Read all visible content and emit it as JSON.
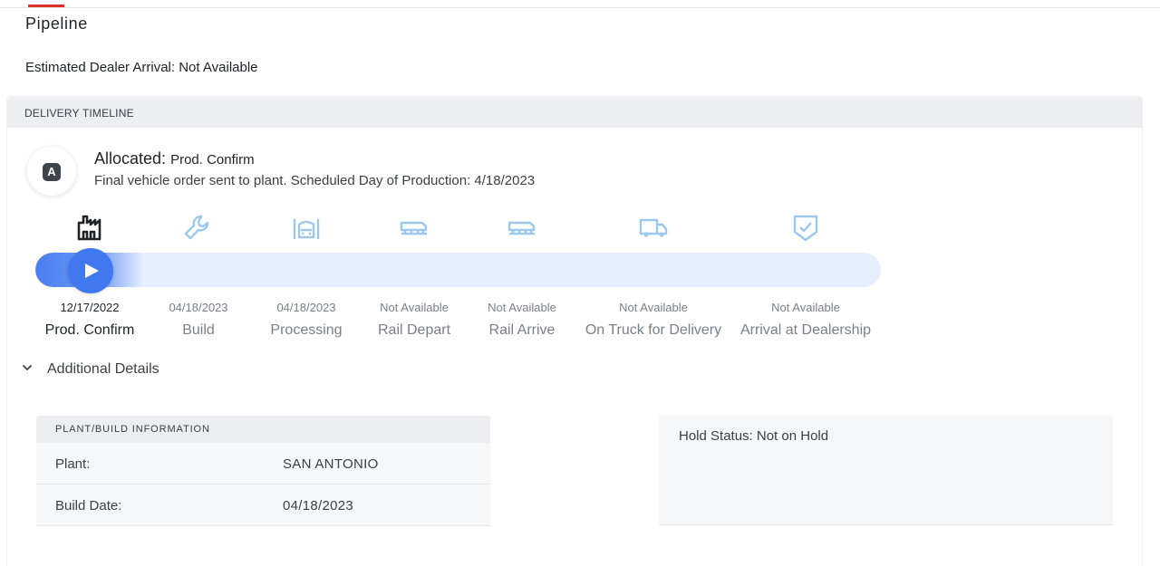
{
  "page": {
    "title": "Pipeline",
    "estimated_arrival": "Estimated Dealer Arrival: Not Available"
  },
  "timeline": {
    "header": "DELIVERY TIMELINE",
    "status_badge_letter": "A",
    "status_label": "Allocated:",
    "status_sub": "Prod. Confirm",
    "status_description": "Final vehicle order sent to plant. Scheduled Day of Production: 4/18/2023",
    "progress_fraction": 0.0,
    "colors": {
      "accent": "#3f78ef",
      "track": "#e7efff",
      "inactive_icon": "#9cc8ee",
      "active_icon": "#1f2328"
    },
    "stages": [
      {
        "icon": "factory-icon",
        "date": "12/17/2022",
        "label": "Prod. Confirm",
        "active": true
      },
      {
        "icon": "wrench-icon",
        "date": "04/18/2023",
        "label": "Build",
        "active": false
      },
      {
        "icon": "car-processing-icon",
        "date": "04/18/2023",
        "label": "Processing",
        "active": false
      },
      {
        "icon": "rail-depart-icon",
        "date": "Not Available",
        "label": "Rail Depart",
        "active": false
      },
      {
        "icon": "rail-arrive-icon",
        "date": "Not Available",
        "label": "Rail Arrive",
        "active": false
      },
      {
        "icon": "truck-icon",
        "date": "Not Available",
        "label": "On Truck for Delivery",
        "active": false
      },
      {
        "icon": "shield-check-icon",
        "date": "Not Available",
        "label": "Arrival at Dealership",
        "active": false
      }
    ]
  },
  "details": {
    "toggle_label": "Additional Details",
    "plant": {
      "header": "PLANT/BUILD INFORMATION",
      "rows": [
        {
          "key": "Plant:",
          "value": "SAN ANTONIO"
        },
        {
          "key": "Build Date:",
          "value": "04/18/2023"
        }
      ]
    },
    "hold_status": "Hold Status: Not on Hold"
  }
}
